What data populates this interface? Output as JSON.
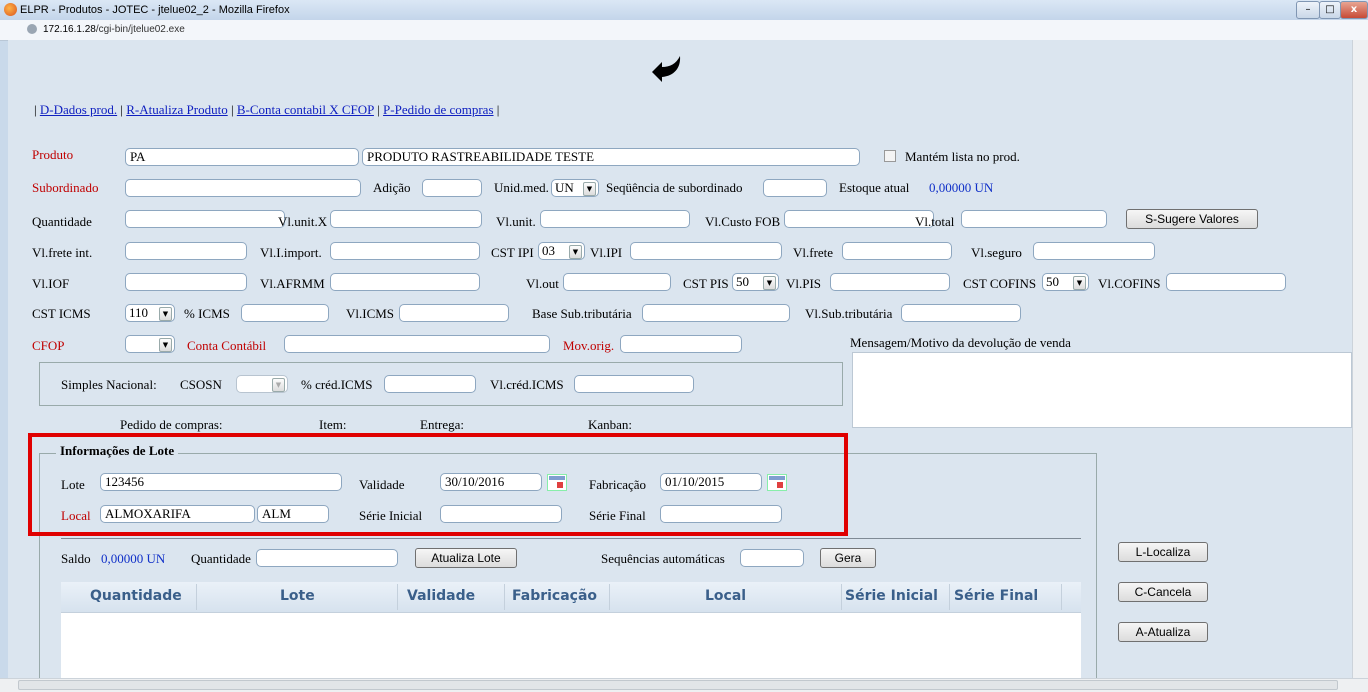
{
  "window": {
    "title": "ELPR - Produtos - JOTEC - jtelue02_2 - Mozilla Firefox",
    "url_host": "172.16.1.28",
    "url_path": "/cgi-bin/jtelue02.exe",
    "minimize": "–",
    "maximize": "□",
    "close": "x"
  },
  "menu": {
    "items": [
      "D-Dados prod.",
      "R-Atualiza Produto",
      "B-Conta contabil X CFOP",
      "P-Pedido de compras"
    ]
  },
  "form": {
    "produto_label": "Produto",
    "produto_code": "PA",
    "produto_desc": "PRODUTO RASTREABILIDADE TESTE",
    "mantem_label": "Mantém lista no prod.",
    "subordinado_label": "Subordinado",
    "adicao_label": "Adição",
    "unid_label": "Unid.med.",
    "unid_value": "UN",
    "seq_sub_label": "Seqüência de subordinado",
    "estoque_label": "Estoque atual",
    "estoque_value": "0,00000 UN",
    "quantidade_label": "Quantidade",
    "vlunitx_label": "Vl.unit.X",
    "vlunit_label": "Vl.unit.",
    "vlcustofob_label": "Vl.Custo FOB",
    "vltotal_label": "Vl.total",
    "sugere_button": "S-Sugere Valores",
    "vlfreteint_label": "Vl.frete int.",
    "vliimport_label": "Vl.I.import.",
    "cstipi_label": "CST IPI",
    "cstipi_value": "03",
    "vlipi_label": "Vl.IPI",
    "vlfrete_label": "Vl.frete",
    "vlseguro_label": "Vl.seguro",
    "vliof_label": "Vl.IOF",
    "vlafrmm_label": "Vl.AFRMM",
    "vlout_label": "Vl.out",
    "cstpis_label": "CST PIS",
    "cstpis_value": "50",
    "vlpis_label": "Vl.PIS",
    "cstcofins_label": "CST COFINS",
    "cstcofins_value": "50",
    "vlcofins_label": "Vl.COFINS",
    "csticms_label": "CST ICMS",
    "csticms_value": "110",
    "picms_label": "% ICMS",
    "vlicms_label": "Vl.ICMS",
    "basesub_label": "Base Sub.tributária",
    "vlsub_label": "Vl.Sub.tributária",
    "cfop_label": "CFOP",
    "conta_label": "Conta Contábil",
    "movorig_label": "Mov.orig.",
    "mensagem_label": "Mensagem/Motivo da devolução de venda",
    "simples_label": "Simples Nacional:",
    "csosn_label": "CSOSN",
    "pcred_label": "% créd.ICMS",
    "vlcred_label": "Vl.créd.ICMS",
    "pedido_label": "Pedido de compras:",
    "item_label": "Item:",
    "entrega_label": "Entrega:",
    "kanban_label": "Kanban:"
  },
  "lote": {
    "legend": "Informações de Lote",
    "lote_label": "Lote",
    "lote_value": "123456",
    "validade_label": "Validade",
    "validade_value": "30/10/2016",
    "fabricacao_label": "Fabricação",
    "fabricacao_value": "01/10/2015",
    "local_label": "Local",
    "local_value": "ALMOXARIFA",
    "local_code": "ALM",
    "serie_ini_label": "Série Inicial",
    "serie_fim_label": "Série Final",
    "saldo_label": "Saldo",
    "saldo_value": "0,00000 UN",
    "quantidade_label": "Quantidade",
    "atualiza_button": "Atualiza Lote",
    "seq_auto_label": "Sequências automáticas",
    "gera_button": "Gera",
    "table_headers": [
      "Quantidade",
      "Lote",
      "Validade",
      "Fabricação",
      "Local",
      "Série Inicial",
      "Série Final"
    ]
  },
  "side_buttons": {
    "localiza": "L-Localiza",
    "cancela": "C-Cancela",
    "atualiza": "A-Atualiza"
  },
  "colors": {
    "highlight_box": "#e00000",
    "link": "#1020c0",
    "required_label": "#c00000",
    "table_header_text": "#3a5f8a"
  }
}
